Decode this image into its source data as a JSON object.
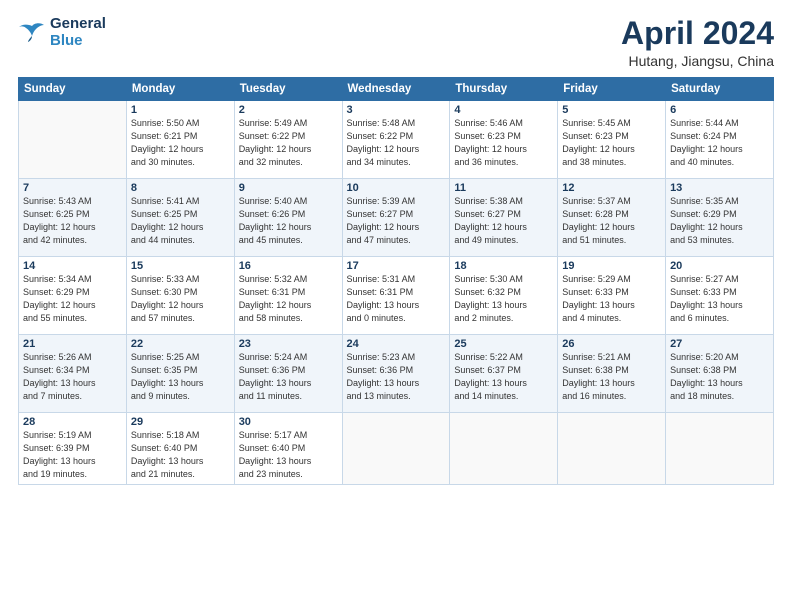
{
  "logo": {
    "line1": "General",
    "line2": "Blue"
  },
  "title": "April 2024",
  "location": "Hutang, Jiangsu, China",
  "days_header": [
    "Sunday",
    "Monday",
    "Tuesday",
    "Wednesday",
    "Thursday",
    "Friday",
    "Saturday"
  ],
  "weeks": [
    [
      {
        "day": "",
        "info": ""
      },
      {
        "day": "1",
        "info": "Sunrise: 5:50 AM\nSunset: 6:21 PM\nDaylight: 12 hours\nand 30 minutes."
      },
      {
        "day": "2",
        "info": "Sunrise: 5:49 AM\nSunset: 6:22 PM\nDaylight: 12 hours\nand 32 minutes."
      },
      {
        "day": "3",
        "info": "Sunrise: 5:48 AM\nSunset: 6:22 PM\nDaylight: 12 hours\nand 34 minutes."
      },
      {
        "day": "4",
        "info": "Sunrise: 5:46 AM\nSunset: 6:23 PM\nDaylight: 12 hours\nand 36 minutes."
      },
      {
        "day": "5",
        "info": "Sunrise: 5:45 AM\nSunset: 6:23 PM\nDaylight: 12 hours\nand 38 minutes."
      },
      {
        "day": "6",
        "info": "Sunrise: 5:44 AM\nSunset: 6:24 PM\nDaylight: 12 hours\nand 40 minutes."
      }
    ],
    [
      {
        "day": "7",
        "info": "Sunrise: 5:43 AM\nSunset: 6:25 PM\nDaylight: 12 hours\nand 42 minutes."
      },
      {
        "day": "8",
        "info": "Sunrise: 5:41 AM\nSunset: 6:25 PM\nDaylight: 12 hours\nand 44 minutes."
      },
      {
        "day": "9",
        "info": "Sunrise: 5:40 AM\nSunset: 6:26 PM\nDaylight: 12 hours\nand 45 minutes."
      },
      {
        "day": "10",
        "info": "Sunrise: 5:39 AM\nSunset: 6:27 PM\nDaylight: 12 hours\nand 47 minutes."
      },
      {
        "day": "11",
        "info": "Sunrise: 5:38 AM\nSunset: 6:27 PM\nDaylight: 12 hours\nand 49 minutes."
      },
      {
        "day": "12",
        "info": "Sunrise: 5:37 AM\nSunset: 6:28 PM\nDaylight: 12 hours\nand 51 minutes."
      },
      {
        "day": "13",
        "info": "Sunrise: 5:35 AM\nSunset: 6:29 PM\nDaylight: 12 hours\nand 53 minutes."
      }
    ],
    [
      {
        "day": "14",
        "info": "Sunrise: 5:34 AM\nSunset: 6:29 PM\nDaylight: 12 hours\nand 55 minutes."
      },
      {
        "day": "15",
        "info": "Sunrise: 5:33 AM\nSunset: 6:30 PM\nDaylight: 12 hours\nand 57 minutes."
      },
      {
        "day": "16",
        "info": "Sunrise: 5:32 AM\nSunset: 6:31 PM\nDaylight: 12 hours\nand 58 minutes."
      },
      {
        "day": "17",
        "info": "Sunrise: 5:31 AM\nSunset: 6:31 PM\nDaylight: 13 hours\nand 0 minutes."
      },
      {
        "day": "18",
        "info": "Sunrise: 5:30 AM\nSunset: 6:32 PM\nDaylight: 13 hours\nand 2 minutes."
      },
      {
        "day": "19",
        "info": "Sunrise: 5:29 AM\nSunset: 6:33 PM\nDaylight: 13 hours\nand 4 minutes."
      },
      {
        "day": "20",
        "info": "Sunrise: 5:27 AM\nSunset: 6:33 PM\nDaylight: 13 hours\nand 6 minutes."
      }
    ],
    [
      {
        "day": "21",
        "info": "Sunrise: 5:26 AM\nSunset: 6:34 PM\nDaylight: 13 hours\nand 7 minutes."
      },
      {
        "day": "22",
        "info": "Sunrise: 5:25 AM\nSunset: 6:35 PM\nDaylight: 13 hours\nand 9 minutes."
      },
      {
        "day": "23",
        "info": "Sunrise: 5:24 AM\nSunset: 6:36 PM\nDaylight: 13 hours\nand 11 minutes."
      },
      {
        "day": "24",
        "info": "Sunrise: 5:23 AM\nSunset: 6:36 PM\nDaylight: 13 hours\nand 13 minutes."
      },
      {
        "day": "25",
        "info": "Sunrise: 5:22 AM\nSunset: 6:37 PM\nDaylight: 13 hours\nand 14 minutes."
      },
      {
        "day": "26",
        "info": "Sunrise: 5:21 AM\nSunset: 6:38 PM\nDaylight: 13 hours\nand 16 minutes."
      },
      {
        "day": "27",
        "info": "Sunrise: 5:20 AM\nSunset: 6:38 PM\nDaylight: 13 hours\nand 18 minutes."
      }
    ],
    [
      {
        "day": "28",
        "info": "Sunrise: 5:19 AM\nSunset: 6:39 PM\nDaylight: 13 hours\nand 19 minutes."
      },
      {
        "day": "29",
        "info": "Sunrise: 5:18 AM\nSunset: 6:40 PM\nDaylight: 13 hours\nand 21 minutes."
      },
      {
        "day": "30",
        "info": "Sunrise: 5:17 AM\nSunset: 6:40 PM\nDaylight: 13 hours\nand 23 minutes."
      },
      {
        "day": "",
        "info": ""
      },
      {
        "day": "",
        "info": ""
      },
      {
        "day": "",
        "info": ""
      },
      {
        "day": "",
        "info": ""
      }
    ]
  ]
}
